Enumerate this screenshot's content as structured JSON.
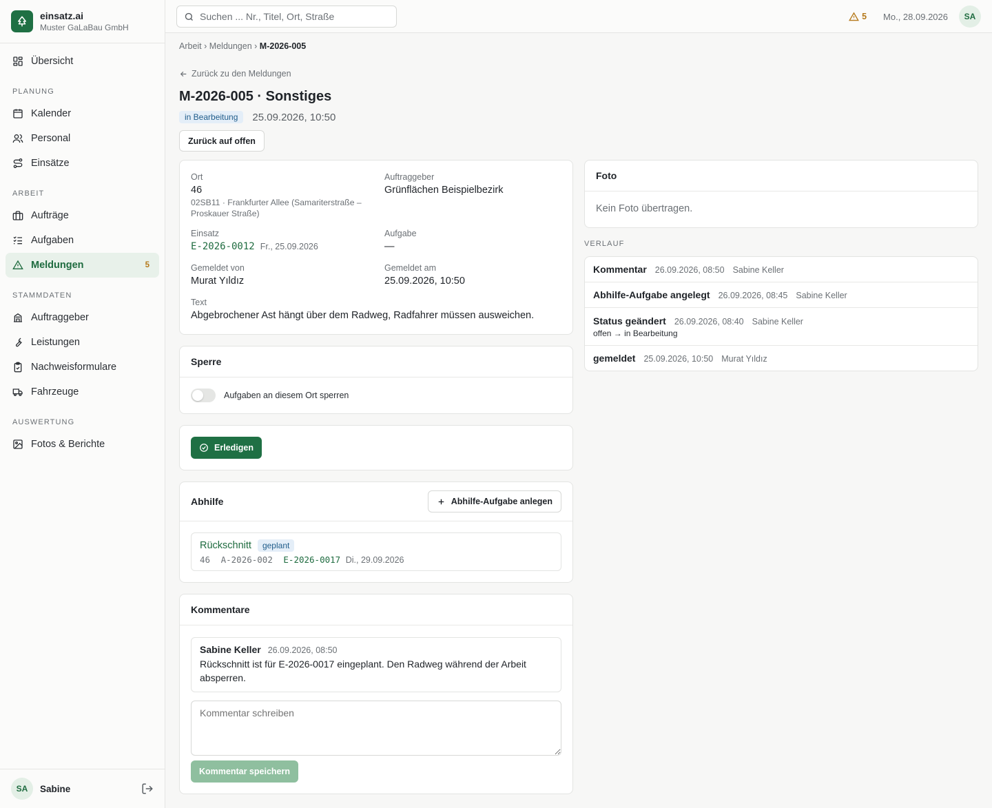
{
  "brand": {
    "name": "einsatz.ai",
    "company": "Muster GaLaBau GmbH"
  },
  "nav": {
    "overview": "Übersicht",
    "sections": {
      "planung": "PLANUNG",
      "arbeit": "ARBEIT",
      "stammdaten": "STAMMDATEN",
      "auswertung": "AUSWERTUNG"
    },
    "kalender": "Kalender",
    "personal": "Personal",
    "einsaetze": "Einsätze",
    "auftraege": "Aufträge",
    "aufgaben": "Aufgaben",
    "meldungen": "Meldungen",
    "meldungen_badge": "5",
    "auftraggeber": "Auftraggeber",
    "leistungen": "Leistungen",
    "nachweisformulare": "Nachweisformulare",
    "fahrzeuge": "Fahrzeuge",
    "fotos": "Fotos & Berichte"
  },
  "user": {
    "initials": "SA",
    "name": "Sabine"
  },
  "topbar": {
    "search_placeholder": "Suchen ... Nr., Titel, Ort, Straße",
    "alert_count": "5",
    "date": "Mo., 28.09.2026",
    "initials": "SA"
  },
  "breadcrumb": {
    "a": "Arbeit",
    "b": "Meldungen",
    "current": "M-2026-005",
    "sep": "›"
  },
  "back_link": "Zurück zu den Meldungen",
  "title": "M-2026-005 · Sonstiges",
  "status": {
    "label": "in Bearbeitung",
    "datetime": "25.09.2026, 10:50"
  },
  "reopen_button": "Zurück auf offen",
  "details": {
    "ort_label": "Ort",
    "ort_value": "46",
    "ort_desc": "02SB11 · Frankfurter Allee (Samariterstraße – Proskauer Straße)",
    "auftraggeber_label": "Auftraggeber",
    "auftraggeber_value": "Grünflächen Beispielbezirk",
    "einsatz_label": "Einsatz",
    "einsatz_value": "E-2026-0012",
    "einsatz_date": "Fr., 25.09.2026",
    "aufgabe_label": "Aufgabe",
    "aufgabe_value": "—",
    "gemeldet_von_label": "Gemeldet von",
    "gemeldet_von_value": "Murat Yıldız",
    "gemeldet_am_label": "Gemeldet am",
    "gemeldet_am_value": "25.09.2026, 10:50",
    "text_label": "Text",
    "text_value": "Abgebrochener Ast hängt über dem Radweg, Radfahrer müssen ausweichen."
  },
  "sperre": {
    "title": "Sperre",
    "toggle_label": "Aufgaben an diesem Ort sperren"
  },
  "erledigen_button": "Erledigen",
  "abhilfe": {
    "title": "Abhilfe",
    "add_button": "Abhilfe-Aufgabe anlegen",
    "item": {
      "title": "Rückschnitt",
      "status": "geplant",
      "ort": "46",
      "auftrag": "A-2026-002",
      "einsatz": "E-2026-0017",
      "date": "Di., 29.09.2026"
    }
  },
  "kommentare": {
    "title": "Kommentare",
    "comment": {
      "author": "Sabine Keller",
      "datetime": "26.09.2026, 08:50",
      "text": "Rückschnitt ist für E-2026-0017 eingeplant. Den Radweg während der Arbeit absperren."
    },
    "placeholder": "Kommentar schreiben",
    "save_button": "Kommentar speichern"
  },
  "foto": {
    "title": "Foto",
    "empty": "Kein Foto übertragen."
  },
  "verlauf": {
    "title": "VERLAUF",
    "entries": [
      {
        "title": "Kommentar",
        "datetime": "26.09.2026, 08:50",
        "user": "Sabine Keller",
        "sub": ""
      },
      {
        "title": "Abhilfe-Aufgabe angelegt",
        "datetime": "26.09.2026, 08:45",
        "user": "Sabine Keller",
        "sub": ""
      },
      {
        "title": "Status geändert",
        "datetime": "26.09.2026, 08:40",
        "user": "Sabine Keller",
        "sub": "offen → in Bearbeitung"
      },
      {
        "title": "gemeldet",
        "datetime": "25.09.2026, 10:50",
        "user": "Murat Yıldız",
        "sub": ""
      }
    ]
  }
}
